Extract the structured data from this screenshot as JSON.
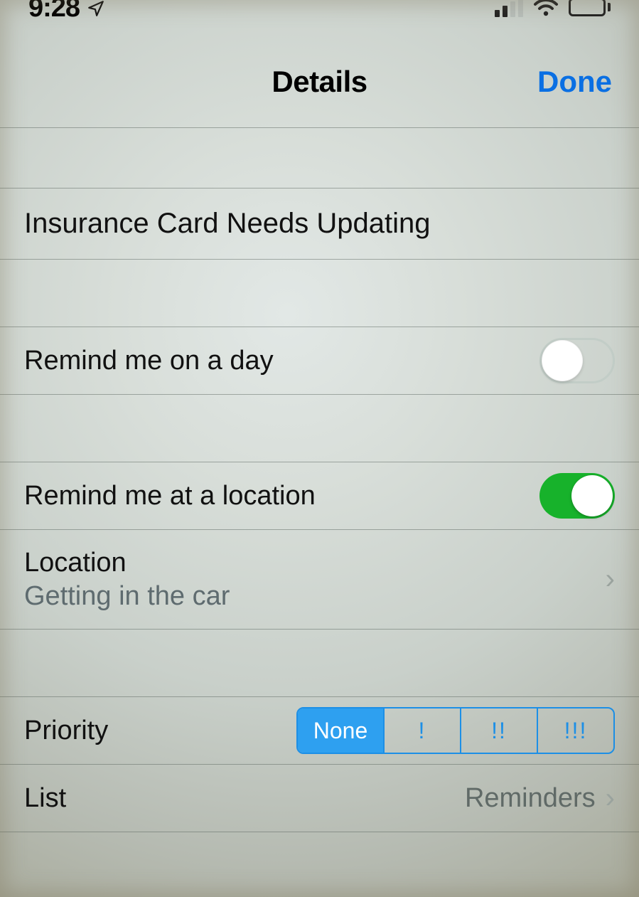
{
  "status": {
    "time": "9:28"
  },
  "nav": {
    "title": "Details",
    "done": "Done"
  },
  "reminder": {
    "title": "Insurance Card Needs Updating"
  },
  "dayRemind": {
    "label": "Remind me on a day",
    "on": false
  },
  "locRemind": {
    "label": "Remind me at a location",
    "on": true
  },
  "location": {
    "label": "Location",
    "value": "Getting in the car"
  },
  "priority": {
    "label": "Priority",
    "options": [
      "None",
      "!",
      "!!",
      "!!!"
    ],
    "selectedIndex": 0
  },
  "list": {
    "label": "List",
    "value": "Reminders"
  }
}
